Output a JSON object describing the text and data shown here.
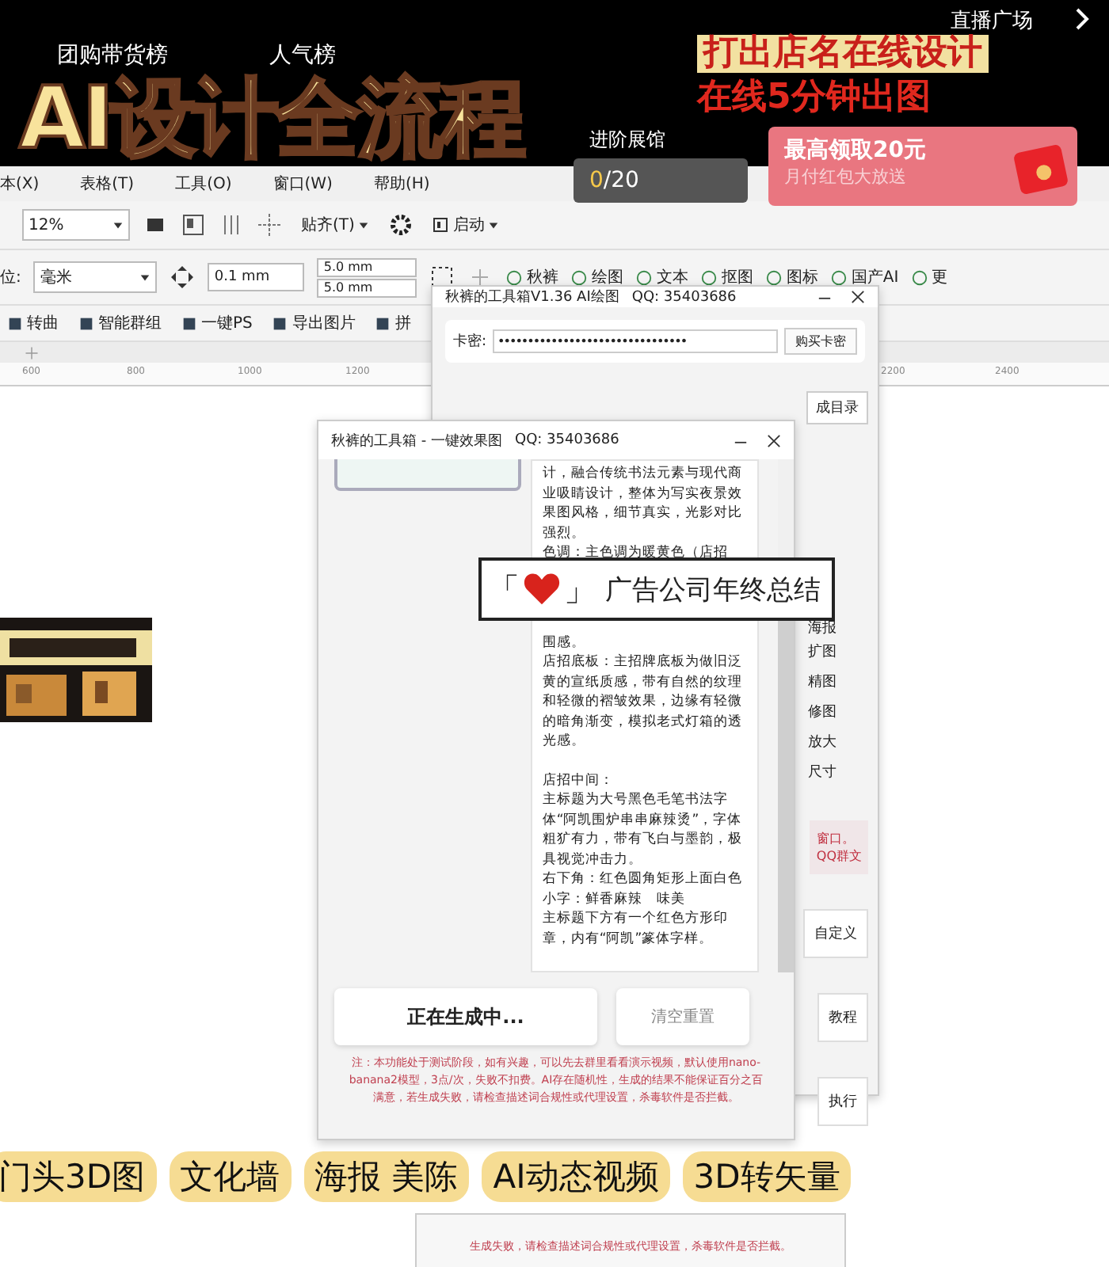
{
  "banner": {
    "title": "AI设计全流程",
    "nav": [
      {
        "label": "团购带货榜"
      },
      {
        "label": "人气榜"
      }
    ],
    "promo_lines": [
      "打出店名在线设计",
      "在线5分钟出图"
    ],
    "live_square": "直播广场",
    "progress": {
      "label": "进阶展馆",
      "current": "0",
      "total": "/20"
    },
    "reward": {
      "title": "最高领取20元",
      "subtitle": "月付红包大放送"
    }
  },
  "menu": [
    "本(X)",
    "表格(T)",
    "工具(O)",
    "窗口(W)",
    "帮助(H)"
  ],
  "toolbar1": {
    "zoom": "12%",
    "snap": "贴齐(T)",
    "launch": "启动"
  },
  "toolbar2": {
    "unit_label": "位:",
    "unit": "毫米",
    "nudge": "0.1 mm",
    "dup_x": "5.0 mm",
    "dup_y": "5.0 mm",
    "plugins": [
      {
        "label": "秋裤"
      },
      {
        "label": "绘图"
      },
      {
        "label": "文本"
      },
      {
        "label": "抠图"
      },
      {
        "label": "图标"
      },
      {
        "label": "国产AI"
      },
      {
        "label": "更"
      }
    ]
  },
  "toolbar3": [
    {
      "label": "转曲"
    },
    {
      "label": "智能群组"
    },
    {
      "label": "一键PS"
    },
    {
      "label": "导出图片"
    },
    {
      "label": "拼"
    }
  ],
  "ruler": [
    "600",
    "800",
    "1000",
    "1200",
    "2200",
    "2400"
  ],
  "canvas_image": {
    "kind": "picture"
  },
  "window_main": {
    "title": "秋裤的工具箱V1.36 AI绘图",
    "qq": "QQ:  35403686",
    "key_label": "卡密:",
    "key_value": "••••••••••••••••••••••••••••••••",
    "buy": "购买卡密",
    "side_items": [
      {
        "label": "成目录",
        "kind": "button"
      },
      {
        "label": "海报",
        "kind": "item"
      },
      {
        "label": "扩图",
        "kind": "item"
      },
      {
        "label": "精图",
        "kind": "item"
      },
      {
        "label": "修图",
        "kind": "item"
      },
      {
        "label": "放大",
        "kind": "item"
      },
      {
        "label": "尺寸",
        "kind": "item"
      }
    ],
    "note": [
      "窗口。",
      "QQ群文"
    ],
    "buttons": [
      "自定义",
      "教程",
      "执行"
    ]
  },
  "window_effect": {
    "title": "秋裤的工具箱 - 一键效果图",
    "qq": "QQ:  35403686",
    "prompt_top": [
      "计，融合传统书法元素与现代商业吸睛设计，整体为写实夜景效果图风格，细节真实，光影对比强烈。",
      "色调：主色调为暖黄色（店招"
    ],
    "prompt_bottom": [
      [
        "围感。",
        "店招底板：主招牌底板为做旧泛黄的宣纸质感，带有自然的纹理和轻微的褶皱效果，边缘有轻微的暗角渐变，模拟老式灯箱的透光感。"
      ],
      [
        "店招中间：",
        "主标题为大号黑色毛笔书法字体“阿凯围炉串串麻辣烫”，字体粗犷有力，带有飞白与墨韵，极具视觉冲击力。",
        "右下角：红色圆角矩形上面白色小字：鲜香麻辣　味美",
        "主标题下方有一个红色方形印章，内有“阿凯”篆体字样。"
      ]
    ],
    "generate": "正在生成中...",
    "reset": "清空重置",
    "note": "注：本功能处于测试阶段，如有兴趣，可以先去群里看看演示视频，默认使用nano-banana2模型，3点/次，失败不扣费。AI存在随机性，生成的结果不能保证百分之百满意，若生成失败，请检查描述词合规性或代理设置，杀毒软件是否拦截。"
  },
  "sticker": {
    "open": "「",
    "close": "」",
    "text": "广告公司年终总结"
  },
  "tags": [
    {
      "label": "门头3D图"
    },
    {
      "label": "文化墙"
    },
    {
      "label": "海报 美陈"
    },
    {
      "label": "AI动态视频"
    },
    {
      "label": "3D转矢量"
    }
  ],
  "bottom_note": "生成失败，请检查描述词合规性或代理设置，杀毒软件是否拦截。"
}
